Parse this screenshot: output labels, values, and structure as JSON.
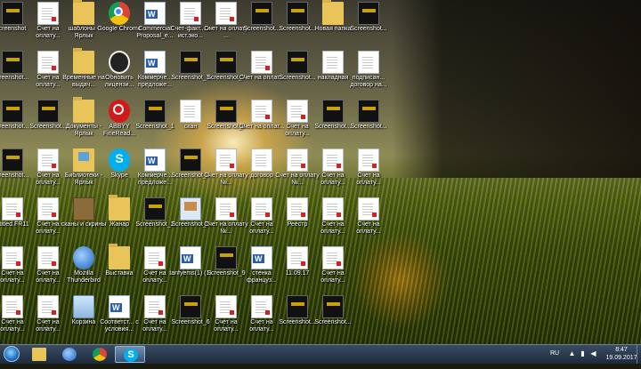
{
  "desktop": {
    "icons": [
      {
        "label": "creenshot",
        "type": "thumb"
      },
      {
        "label": "Счет на оплату...",
        "type": "pdf"
      },
      {
        "label": "шаблоны - Ярлык",
        "type": "folder"
      },
      {
        "label": "Google Chrome",
        "type": "chrome"
      },
      {
        "label": "Commercial Proposal_e...",
        "type": "word"
      },
      {
        "label": "Счет-факт... и ист.эко...",
        "type": "pdf"
      },
      {
        "label": "Счет на оплату ...",
        "type": "pdf"
      },
      {
        "label": "Screenshot...",
        "type": "thumb"
      },
      {
        "label": "Screenshot...",
        "type": "thumb"
      },
      {
        "label": "Новая папка",
        "type": "folder"
      },
      {
        "label": "Screenshot...",
        "type": "thumb"
      },
      {
        "label": "creenshot...",
        "type": "thumb"
      },
      {
        "label": "Счет на оплату...",
        "type": "pdf"
      },
      {
        "label": "Временные на выдач...",
        "type": "folder"
      },
      {
        "label": "Обновить лицензи...",
        "type": "update"
      },
      {
        "label": "Коммерче... предложе...",
        "type": "word"
      },
      {
        "label": "Screenshot_3",
        "type": "thumb"
      },
      {
        "label": "Screenshot_7",
        "type": "thumb"
      },
      {
        "label": "Счет на оплат...",
        "type": "pdf"
      },
      {
        "label": "Screenshot...",
        "type": "thumb"
      },
      {
        "label": "накладная",
        "type": "doc"
      },
      {
        "label": "подписан... договор на...",
        "type": "doc"
      },
      {
        "label": "creenshot...",
        "type": "thumb"
      },
      {
        "label": "Screenshot...",
        "type": "thumb"
      },
      {
        "label": "Документы - Ярлык",
        "type": "folder"
      },
      {
        "label": "ABBYY FineRead...",
        "type": "abbyy"
      },
      {
        "label": "Screenshot_1",
        "type": "thumb"
      },
      {
        "label": "скан",
        "type": "doc"
      },
      {
        "label": "Screenshot_8",
        "type": "thumb"
      },
      {
        "label": "Счет на оплат...",
        "type": "pdf"
      },
      {
        "label": "Счет на оплату...",
        "type": "pdf"
      },
      {
        "label": "Screenshot...",
        "type": "thumb"
      },
      {
        "label": "Screenshot...",
        "type": "thumb"
      },
      {
        "label": "creenshot...",
        "type": "thumb"
      },
      {
        "label": "Счет на оплату...",
        "type": "pdf"
      },
      {
        "label": "Библиотеки - Ярлык",
        "type": "library"
      },
      {
        "label": "Skype",
        "type": "skype"
      },
      {
        "label": "Коммерче... предложе...",
        "type": "word"
      },
      {
        "label": "Screenshot_4",
        "type": "thumb"
      },
      {
        "label": "Счет на оплату №...",
        "type": "pdf"
      },
      {
        "label": "договор",
        "type": "doc"
      },
      {
        "label": "Счет на оплату №...",
        "type": "pdf"
      },
      {
        "label": "Счет на оплату...",
        "type": "pdf"
      },
      {
        "label": "Счет на оплату...",
        "type": "pdf"
      },
      {
        "label": "ntitled.FR11",
        "type": "pdf"
      },
      {
        "label": "Счет на оплату...",
        "type": "pdf"
      },
      {
        "label": "сканы и скрины",
        "type": "archive"
      },
      {
        "label": "Жанар",
        "type": "folder"
      },
      {
        "label": "Screenshot_2",
        "type": "thumb"
      },
      {
        "label": "Screenshot_5",
        "type": "picture"
      },
      {
        "label": "Счет на оплату №...",
        "type": "pdf"
      },
      {
        "label": "Счет на оплату...",
        "type": "pdf"
      },
      {
        "label": "Реестр",
        "type": "pdf"
      },
      {
        "label": "Счет на оплату...",
        "type": "pdf"
      },
      {
        "label": "Счет на оплату...",
        "type": "pdf"
      },
      {
        "label": "Счет на оплату...",
        "type": "pdf"
      },
      {
        "label": "Счет на оплату...",
        "type": "pdf"
      },
      {
        "label": "Mozilla Thunderbird",
        "type": "thunderbird"
      },
      {
        "label": "Выставка",
        "type": "folder"
      },
      {
        "label": "Счет на оплату...",
        "type": "pdf"
      },
      {
        "label": "tanfyems(1) (1)",
        "type": "word"
      },
      {
        "label": "Screenshot_9",
        "type": "thumb"
      },
      {
        "label": "стенка француз...",
        "type": "word"
      },
      {
        "label": "11.09.17",
        "type": "pdf"
      },
      {
        "label": "Счет на оплату...",
        "type": "pdf"
      },
      {
        "label": "",
        "type": "none"
      },
      {
        "label": "Счет на оплату...",
        "type": "pdf"
      },
      {
        "label": "Счет на оплату...",
        "type": "pdf"
      },
      {
        "label": "Корзина",
        "type": "bin"
      },
      {
        "label": "Соответст... с условия...",
        "type": "word"
      },
      {
        "label": "Счет на оплату...",
        "type": "pdf"
      },
      {
        "label": "Screenshot_6",
        "type": "thumb"
      },
      {
        "label": "Счет на оплату...",
        "type": "pdf"
      },
      {
        "label": "Счет на оплату...",
        "type": "pdf"
      },
      {
        "label": "Screenshot...",
        "type": "thumb"
      },
      {
        "label": "Screenshot...",
        "type": "thumb"
      },
      {
        "label": "",
        "type": "none"
      }
    ]
  },
  "taskbar": {
    "pinned": [
      {
        "name": "explorer-taskbar-button",
        "icon": "folder-icon"
      },
      {
        "name": "thunderbird-taskbar-button",
        "icon": "thunderbird-icon"
      },
      {
        "name": "chrome-taskbar-button",
        "icon": "chrome-icon"
      },
      {
        "name": "skype-taskbar-button",
        "icon": "skype-icon",
        "active": true,
        "glyph": "S"
      }
    ],
    "tray": {
      "language": "RU",
      "time": "8:47",
      "date": "19.09.2017"
    }
  }
}
